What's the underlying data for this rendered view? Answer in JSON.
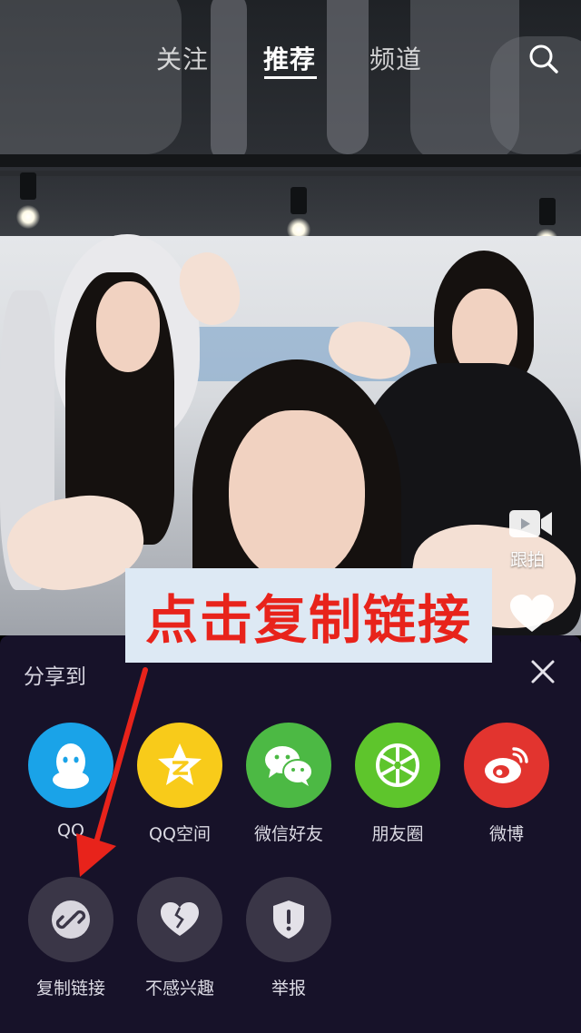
{
  "nav": {
    "tabs": [
      {
        "label": "关注",
        "active": false
      },
      {
        "label": "推荐",
        "active": true
      },
      {
        "label": "频道",
        "active": false
      }
    ],
    "search_icon": "search-icon"
  },
  "video": {
    "follow_shoot_label": "跟拍",
    "follow_shoot_icon": "video-camera-icon",
    "like_icon": "heart-icon"
  },
  "annotation": {
    "text": "点击复制链接",
    "color": "#e8231b"
  },
  "share": {
    "title": "分享到",
    "close_icon": "close-icon",
    "targets": [
      {
        "label": "QQ",
        "icon": "qq-penguin-icon",
        "color": "#1aa3e8"
      },
      {
        "label": "QQ空间",
        "icon": "qzone-star-icon",
        "color": "#f8cb1a"
      },
      {
        "label": "微信好友",
        "icon": "wechat-icon",
        "color": "#4cb944"
      },
      {
        "label": "朋友圈",
        "icon": "moments-shutter-icon",
        "color": "#5ec52c"
      },
      {
        "label": "微博",
        "icon": "weibo-icon",
        "color": "#e2342f"
      }
    ],
    "actions": [
      {
        "label": "复制链接",
        "icon": "link-icon"
      },
      {
        "label": "不感兴趣",
        "icon": "broken-heart-icon"
      },
      {
        "label": "举报",
        "icon": "shield-alert-icon"
      }
    ]
  }
}
